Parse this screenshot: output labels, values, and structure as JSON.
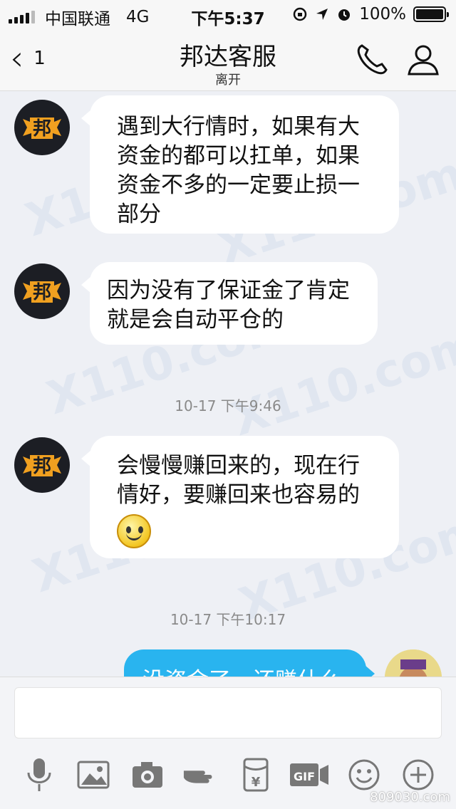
{
  "status": {
    "carrier": "中国联通",
    "network": "4G",
    "time": "下午5:37",
    "battery": "100%"
  },
  "nav": {
    "back_count": "1",
    "title": "邦达客服",
    "subtitle": "离开"
  },
  "avatar_glyph": "邦",
  "messages": [
    {
      "text": "遇到大行情时，如果有大资金的都可以扛单，如果资金不多的一定要止损一部分"
    },
    {
      "text": "因为没有了保证金了肯定就是会自动平仓的"
    },
    {
      "timestamp": "10-17 下午9:46"
    },
    {
      "text": "会慢慢赚回来的，现在行情好，要赚回来也容易的",
      "emoji": "smiley-icon"
    },
    {
      "timestamp": "10-17 下午10:17"
    },
    {
      "text": "没资金了，还赚什么"
    }
  ],
  "watermark": "X110.com",
  "corner_watermark": "809030.com",
  "composer": {
    "placeholder": ""
  },
  "colors": {
    "outgoing": "#29b4ef",
    "accent": "#f0a020"
  }
}
